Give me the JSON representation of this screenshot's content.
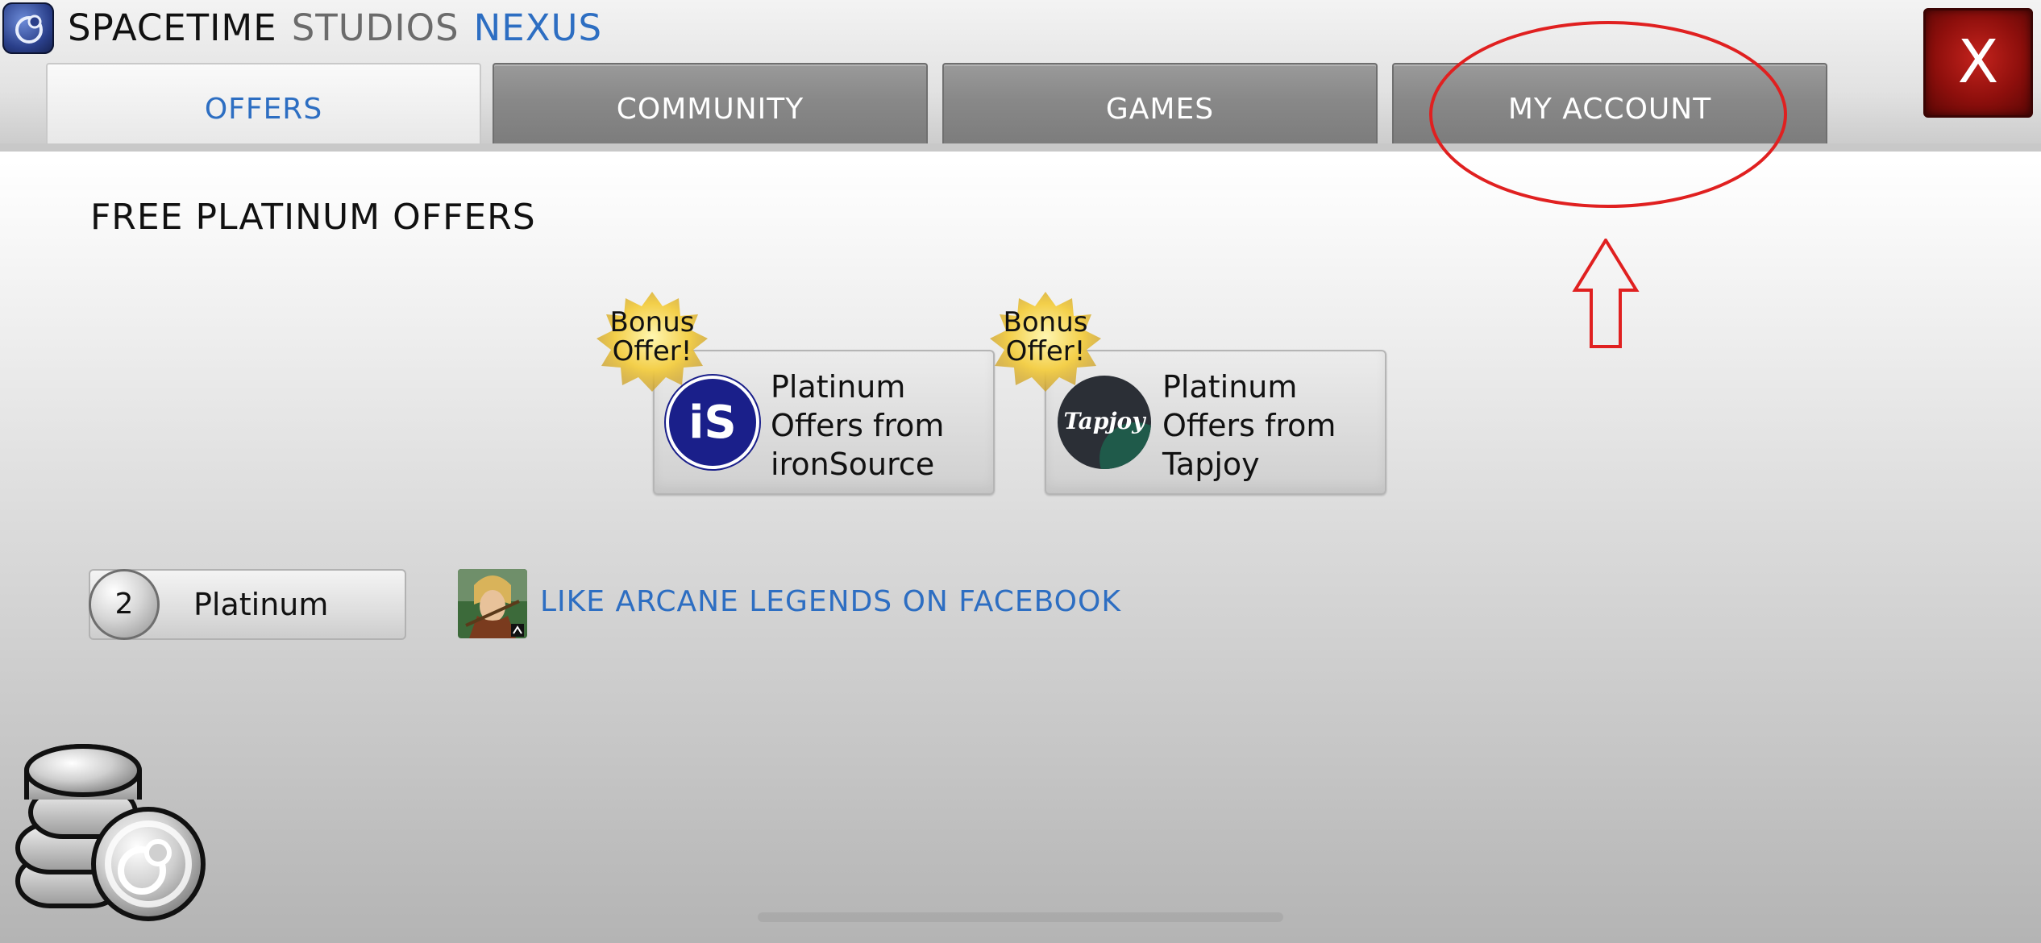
{
  "header": {
    "title_part1": "SPACETIME",
    "title_part2": "STUDIOS",
    "title_part3": "NEXUS",
    "close_label": "X",
    "tabs": [
      {
        "label": "OFFERS",
        "active": true
      },
      {
        "label": "COMMUNITY",
        "active": false
      },
      {
        "label": "GAMES",
        "active": false
      },
      {
        "label": "MY ACCOUNT",
        "active": false
      }
    ]
  },
  "main": {
    "section_title": "FREE PLATINUM OFFERS",
    "offers": [
      {
        "badge": [
          "Bonus",
          "Offer!"
        ],
        "text": [
          "Platinum",
          "Offers from",
          "ironSource"
        ],
        "logo_text": "iS"
      },
      {
        "badge": [
          "Bonus",
          "Offer!"
        ],
        "text": [
          "Platinum",
          "Offers from",
          "Tapjoy"
        ],
        "logo_text": "Tapjoy"
      }
    ],
    "platinum_count": "2",
    "platinum_label": "Platinum",
    "facebook_link": "LIKE ARCANE LEGENDS ON FACEBOOK"
  },
  "colors": {
    "accent_blue": "#2d6ec2",
    "tab_gray": "#888888",
    "close_red": "#8e0f0c",
    "annotation_red": "#e02020"
  }
}
